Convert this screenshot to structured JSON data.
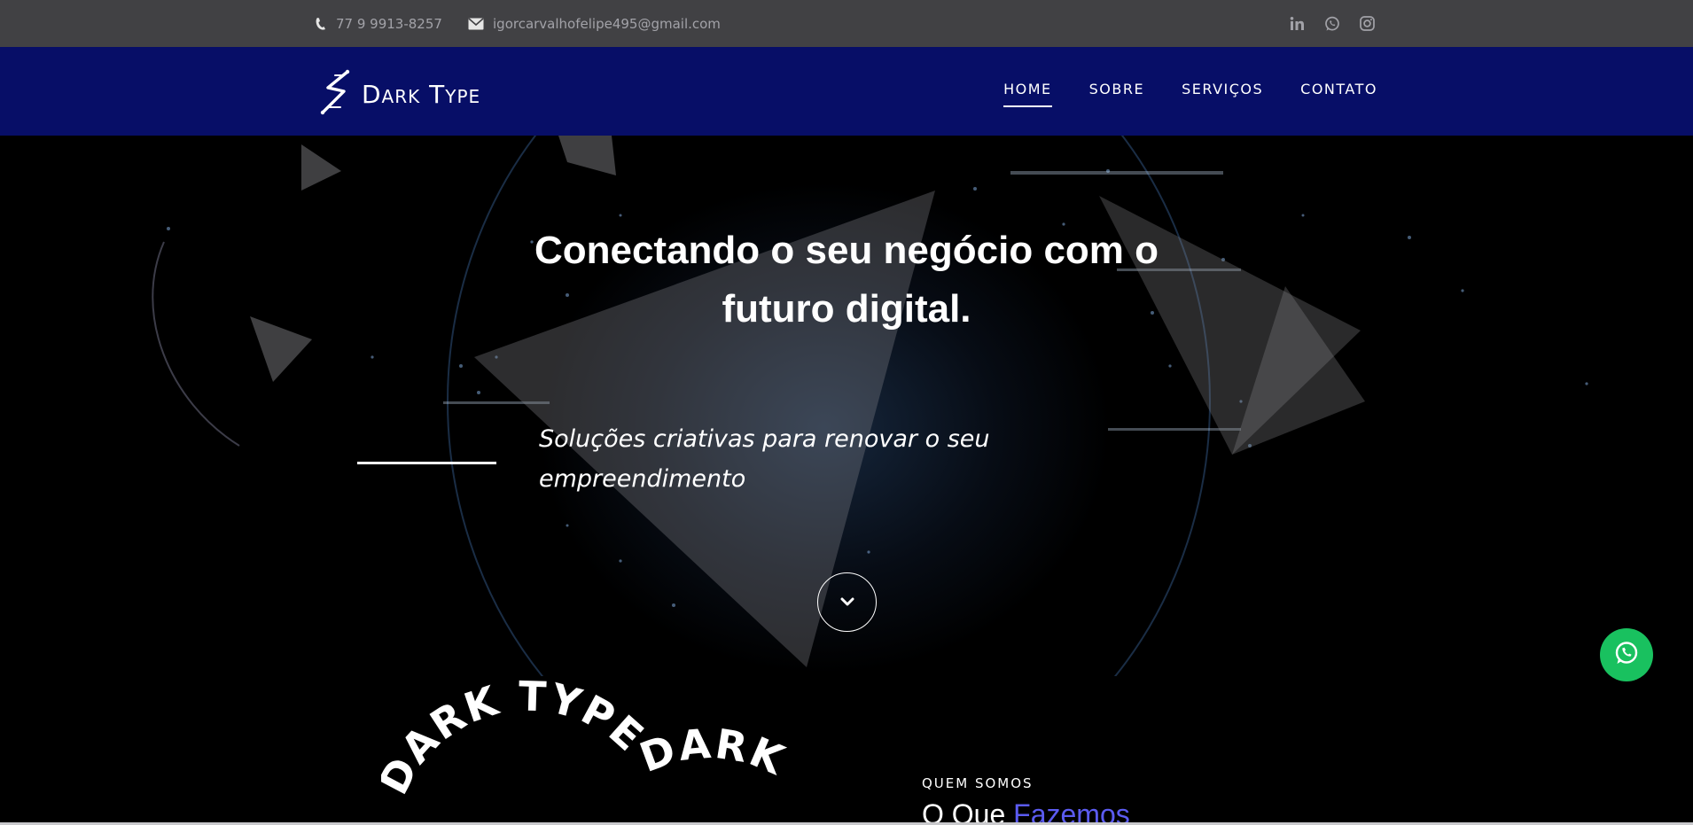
{
  "topbar": {
    "phone": "77 9 9913-8257",
    "email": "igorcarvalhofelipe495@gmail.com",
    "socials": [
      "linkedin-icon",
      "whatsapp-icon",
      "instagram-icon"
    ]
  },
  "brand": {
    "name": "Dark Type"
  },
  "nav": {
    "items": [
      {
        "label": "HOME"
      },
      {
        "label": "SOBRE"
      },
      {
        "label": "SERVIÇOS"
      },
      {
        "label": "CONTATO"
      }
    ],
    "active": "HOME"
  },
  "hero": {
    "title": "Conectando o seu negócio com o futuro digital.",
    "subtitle": "Soluções criativas para renovar o seu empreendimento",
    "scroll_icon": "chevron-down-icon"
  },
  "about": {
    "circle_text_1": "DARK TYPE",
    "circle_text_2": "DARK",
    "eyebrow": "QUEM SOMOS",
    "title_plain": "O Que",
    "title_accent": "Fazemos"
  },
  "colors": {
    "topbar": "#414144",
    "navbar": "#070e67",
    "accent": "#5b5bf0",
    "whatsapp": "#19c15f"
  }
}
